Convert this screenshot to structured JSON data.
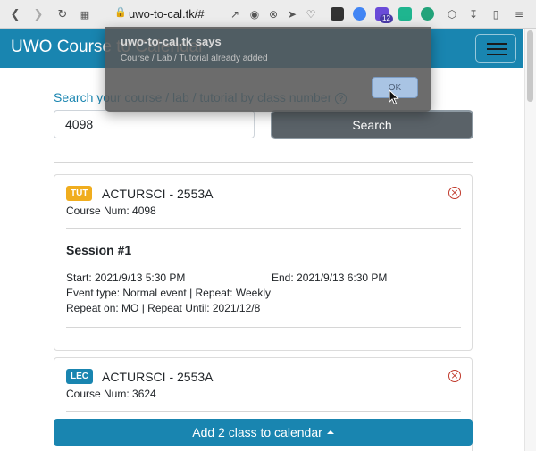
{
  "browser": {
    "url": "uwo-to-cal.tk/#",
    "extension_badge": "12"
  },
  "app": {
    "title": "UWO Course to Calendar"
  },
  "search": {
    "label": "Search your course / lab / tutorial by class number",
    "value": "4098",
    "button_label": "Search"
  },
  "cards": [
    {
      "type_badge": "TUT",
      "badge_color": "#f0ad1e",
      "title": "ACTURSCI - 2553A",
      "course_num": "Course Num: 4098",
      "session_title": "Session #1",
      "start": "Start: 2021/9/13 5:30 PM",
      "end": "End: 2021/9/13 6:30 PM",
      "event_line": "Event type: Normal event | Repeat: Weekly",
      "repeat_line": "Repeat on: MO | Repeat Until: 2021/12/8"
    },
    {
      "type_badge": "LEC",
      "badge_color": "#1985b0",
      "title": "ACTURSCI - 2553A",
      "course_num": "Course Num: 3624"
    }
  ],
  "footer": {
    "add_button_label": "Add 2 class to calendar"
  },
  "dialog": {
    "title": "uwo-to-cal.tk says",
    "message": "Course / Lab / Tutorial already added",
    "ok_label": "OK"
  },
  "colors": {
    "brand": "#1985b0",
    "remove_icon": "#c0392b",
    "search_button": "#5a6268"
  }
}
